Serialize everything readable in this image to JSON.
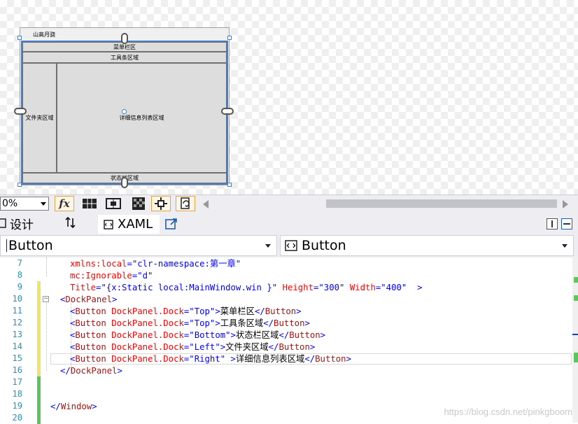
{
  "designer": {
    "window_title": "山高月骁",
    "buttons": {
      "top1": "菜单栏区",
      "top2": "工具条区域",
      "left": "文件夹区域",
      "center": "详细信息列表区域",
      "bottom": "状态栏区域"
    }
  },
  "toolbar": {
    "zoom_value": "0%",
    "icons": [
      "fx-icon",
      "grid-icon",
      "snap-icon",
      "checker-icon",
      "artboard-icon",
      "refresh-icon"
    ]
  },
  "tabs": {
    "design_label": "设计",
    "swap_icon": "swap-icon",
    "xaml_label": "XAML"
  },
  "selectors": {
    "left_value": "Button",
    "right_value": "Button"
  },
  "code": {
    "lines": [
      {
        "num": "7",
        "parts": [
          [
            "attr",
            "xmlns:local"
          ],
          [
            "br",
            "="
          ],
          [
            "val",
            "\"clr-namespace:第一章\""
          ]
        ]
      },
      {
        "num": "8",
        "parts": [
          [
            "attr",
            "mc:Ignorable"
          ],
          [
            "br",
            "="
          ],
          [
            "val",
            "\"d\""
          ]
        ]
      },
      {
        "num": "9",
        "parts": [
          [
            "attr",
            "Title"
          ],
          [
            "br",
            "="
          ],
          [
            "val",
            "\"{x:Static local:MainWindow.win }\""
          ],
          [
            "text",
            " "
          ],
          [
            "attr",
            "Height"
          ],
          [
            "br",
            "="
          ],
          [
            "val",
            "\"300\""
          ],
          [
            "text",
            " "
          ],
          [
            "attr",
            "Width"
          ],
          [
            "br",
            "="
          ],
          [
            "val",
            "\"400\""
          ],
          [
            "text",
            "  "
          ],
          [
            "br",
            ">"
          ]
        ]
      },
      {
        "num": "10",
        "parts": [
          [
            "br",
            "<"
          ],
          [
            "tag",
            "DockPanel"
          ],
          [
            "br",
            ">"
          ]
        ]
      },
      {
        "num": "11",
        "parts": [
          [
            "br",
            "<"
          ],
          [
            "tag",
            "Button"
          ],
          [
            "text",
            " "
          ],
          [
            "attr",
            "DockPanel.Dock"
          ],
          [
            "br",
            "="
          ],
          [
            "val",
            "\"Top\""
          ],
          [
            "br",
            ">"
          ],
          [
            "text",
            "菜单栏区"
          ],
          [
            "br",
            "</"
          ],
          [
            "tag",
            "Button"
          ],
          [
            "br",
            ">"
          ]
        ]
      },
      {
        "num": "12",
        "parts": [
          [
            "br",
            "<"
          ],
          [
            "tag",
            "Button"
          ],
          [
            "text",
            " "
          ],
          [
            "attr",
            "DockPanel.Dock"
          ],
          [
            "br",
            "="
          ],
          [
            "val",
            "\"Top\""
          ],
          [
            "br",
            ">"
          ],
          [
            "text",
            "工具条区域"
          ],
          [
            "br",
            "</"
          ],
          [
            "tag",
            "Button"
          ],
          [
            "br",
            ">"
          ]
        ]
      },
      {
        "num": "13",
        "parts": [
          [
            "br",
            "<"
          ],
          [
            "tag",
            "Button"
          ],
          [
            "text",
            " "
          ],
          [
            "attr",
            "DockPanel.Dock"
          ],
          [
            "br",
            "="
          ],
          [
            "val",
            "\"Bottom\""
          ],
          [
            "br",
            ">"
          ],
          [
            "text",
            "状态栏区域"
          ],
          [
            "br",
            "</"
          ],
          [
            "tag",
            "Button"
          ],
          [
            "br",
            ">"
          ]
        ]
      },
      {
        "num": "14",
        "parts": [
          [
            "br",
            "<"
          ],
          [
            "tag",
            "Button"
          ],
          [
            "text",
            " "
          ],
          [
            "attr",
            "DockPanel.Dock"
          ],
          [
            "br",
            "="
          ],
          [
            "val",
            "\"Left\""
          ],
          [
            "br",
            ">"
          ],
          [
            "text",
            "文件夹区域"
          ],
          [
            "br",
            "</"
          ],
          [
            "tag",
            "Button"
          ],
          [
            "br",
            ">"
          ]
        ]
      },
      {
        "num": "15",
        "parts": [
          [
            "br",
            "<"
          ],
          [
            "tag",
            "Button"
          ],
          [
            "text",
            " "
          ],
          [
            "attr",
            "DockPanel.Dock"
          ],
          [
            "br",
            "="
          ],
          [
            "val",
            "\"Right\""
          ],
          [
            "text",
            " "
          ],
          [
            "br",
            ">"
          ],
          [
            "text",
            "详细信息列表区域"
          ],
          [
            "br",
            "</"
          ],
          [
            "tag",
            "Button"
          ],
          [
            "br",
            ">"
          ]
        ]
      },
      {
        "num": "16",
        "parts": [
          [
            "br",
            "</"
          ],
          [
            "tag",
            "DockPanel"
          ],
          [
            "br",
            ">"
          ]
        ]
      },
      {
        "num": "17",
        "parts": []
      },
      {
        "num": "18",
        "parts": []
      },
      {
        "num": "19",
        "parts": [
          [
            "br",
            "</"
          ],
          [
            "tag",
            "Window"
          ],
          [
            "br",
            ">"
          ]
        ]
      },
      {
        "num": "20",
        "parts": []
      }
    ]
  },
  "watermark": "https://blog.csdn.net/pinkgboom"
}
